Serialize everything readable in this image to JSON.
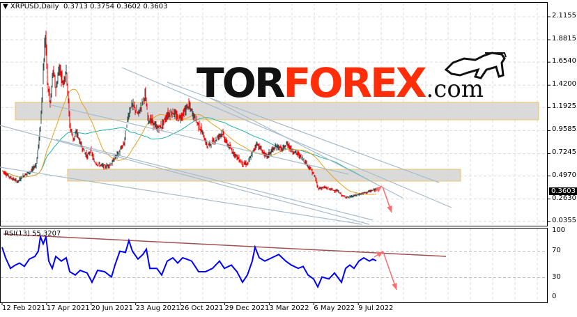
{
  "header": {
    "symbol_label": "XRPUSD,Daily",
    "ohlc": "0.3713 0.3754 0.3602 0.3603",
    "current_price": "0.3603"
  },
  "rsi": {
    "label": "RSI(13) 55.3207",
    "levels": [
      "100",
      "70",
      "30",
      "0"
    ]
  },
  "price_axis": [
    "2.1155",
    "1.8815",
    "1.6540",
    "1.4200",
    "1.1925",
    "0.9585",
    "0.7245",
    "0.4970",
    "0.2630",
    "0.0355"
  ],
  "date_axis": [
    "12 Feb 2021",
    "17 Apr 2021",
    "20 Jun 2021",
    "23 Aug 2021",
    "26 Oct 2021",
    "29 Dec 2021",
    "3 Mar 2022",
    "6 May 2022",
    "9 Jul 2022"
  ],
  "logo": {
    "part1": "TOR",
    "part2": "FOREX",
    "part3": ".com"
  },
  "colors": {
    "bull_candle": "#2f4f4f",
    "bear_candle": "#ff0000",
    "rsi_line": "#0000ff",
    "ma_fast": "#e6a020",
    "ma_slow": "#20b2aa",
    "zone": "#d3d3d3",
    "zone_border": "#f0c060",
    "channel": "#a8bccb",
    "arrow": "#ff6a6a",
    "rsi_trend": "#a05050",
    "logo_red": "#ff2d08"
  },
  "chart_data": {
    "type": "line",
    "title": "XRPUSD,Daily",
    "x_unit": "days since 12 Feb 2021",
    "ylim": [
      0.0355,
      2.1155
    ],
    "price": {
      "day": [
        0,
        12,
        22,
        32,
        42,
        49,
        55,
        59,
        62,
        65,
        69,
        73,
        77,
        82,
        87,
        92,
        97,
        102,
        107,
        112,
        117,
        122,
        127,
        132,
        137,
        147,
        157,
        162,
        167,
        175,
        180,
        185,
        190,
        195,
        200,
        205,
        209,
        215,
        222,
        229,
        237,
        245,
        252,
        259,
        267,
        272,
        279,
        287,
        294,
        299,
        307,
        315,
        322,
        329,
        337,
        345,
        352,
        359,
        365,
        372,
        379,
        387,
        395,
        402,
        409,
        415,
        422,
        429,
        437,
        444,
        449,
        453,
        462,
        472,
        482,
        489,
        497,
        507,
        517,
        527,
        537
      ],
      "close": [
        0.55,
        0.48,
        0.44,
        0.51,
        0.55,
        0.62,
        1.01,
        1.58,
        1.93,
        1.44,
        1.22,
        1.58,
        1.37,
        1.61,
        1.44,
        1.58,
        1.01,
        0.87,
        0.94,
        0.83,
        0.76,
        0.69,
        0.76,
        0.64,
        0.62,
        0.59,
        0.62,
        0.69,
        0.73,
        0.83,
        1.08,
        1.22,
        1.19,
        1.12,
        1.22,
        1.33,
        1.08,
        1.05,
        0.98,
        1.01,
        1.12,
        1.15,
        1.08,
        1.12,
        1.22,
        1.15,
        1.05,
        0.94,
        0.8,
        0.83,
        0.87,
        0.94,
        0.83,
        0.76,
        0.69,
        0.62,
        0.62,
        0.73,
        0.83,
        0.76,
        0.69,
        0.76,
        0.8,
        0.76,
        0.83,
        0.76,
        0.73,
        0.69,
        0.62,
        0.55,
        0.48,
        0.37,
        0.38,
        0.36,
        0.34,
        0.29,
        0.28,
        0.3,
        0.32,
        0.34,
        0.3603
      ]
    },
    "rsi_series": {
      "day": [
        0,
        5,
        12,
        19,
        25,
        32,
        39,
        47,
        52,
        55,
        59,
        63,
        67,
        72,
        77,
        85,
        92,
        97,
        105,
        112,
        122,
        129,
        137,
        147,
        157,
        162,
        169,
        177,
        182,
        187,
        195,
        202,
        207,
        212,
        222,
        229,
        237,
        245,
        252,
        259,
        265,
        272,
        282,
        292,
        302,
        312,
        319,
        329,
        337,
        345,
        352,
        359,
        363,
        369,
        377,
        387,
        397,
        407,
        415,
        425,
        432,
        439,
        447,
        453,
        459,
        469,
        477,
        487,
        493,
        499,
        505,
        512,
        519,
        527,
        532,
        537
      ],
      "value": [
        76,
        60,
        44,
        49,
        52,
        47,
        58,
        62,
        70,
        92,
        81,
        92,
        55,
        44,
        62,
        55,
        60,
        39,
        34,
        41,
        37,
        23,
        41,
        39,
        31,
        49,
        70,
        68,
        86,
        70,
        58,
        65,
        73,
        44,
        44,
        34,
        55,
        60,
        52,
        60,
        58,
        55,
        39,
        39,
        44,
        55,
        44,
        49,
        39,
        23,
        34,
        55,
        76,
        60,
        55,
        60,
        65,
        55,
        49,
        44,
        47,
        34,
        28,
        16,
        31,
        28,
        37,
        23,
        44,
        49,
        44,
        55,
        60,
        55,
        58,
        55.32
      ]
    },
    "zones": [
      [
        1.068,
        1.245
      ],
      [
        0.445,
        0.565
      ]
    ],
    "rsi_levels": [
      70,
      30
    ]
  }
}
